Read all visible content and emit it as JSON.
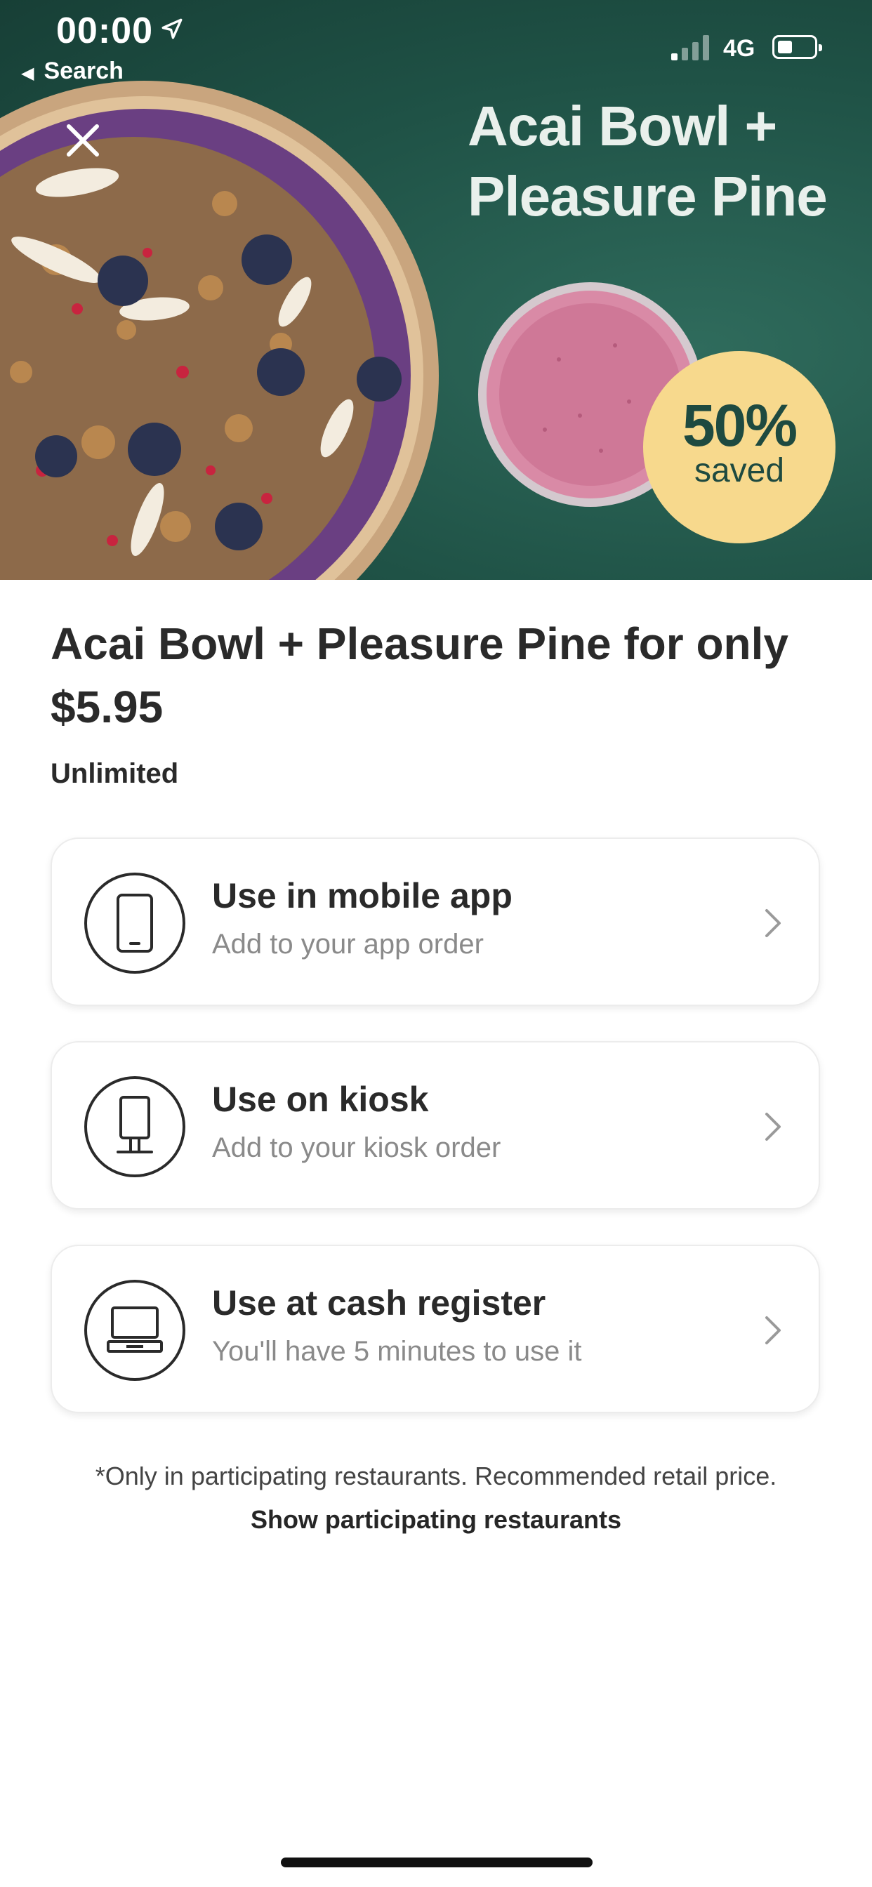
{
  "status_bar": {
    "time": "00:00",
    "back_label": "Search",
    "network": "4G"
  },
  "hero": {
    "title_line1": "Acai Bowl +",
    "title_line2": "Pleasure Pine",
    "badge_percent": "50%",
    "badge_label": "saved",
    "colors": {
      "background": "#1f5246",
      "badge": "#f7d98d"
    }
  },
  "offer": {
    "title_line1": "Acai Bowl + Pleasure Pine for only",
    "title_line2": "$5.95",
    "availability": "Unlimited"
  },
  "options": [
    {
      "title": "Use in mobile app",
      "subtitle": "Add to your app order",
      "icon": "mobile-phone-icon"
    },
    {
      "title": "Use on kiosk",
      "subtitle": "Add to your kiosk order",
      "icon": "kiosk-icon"
    },
    {
      "title": "Use at cash register",
      "subtitle": "You'll have 5 minutes to use it",
      "icon": "cash-register-icon"
    }
  ],
  "footer": {
    "note": "*Only in participating restaurants. Recommended retail price.",
    "link": "Show participating restaurants"
  }
}
